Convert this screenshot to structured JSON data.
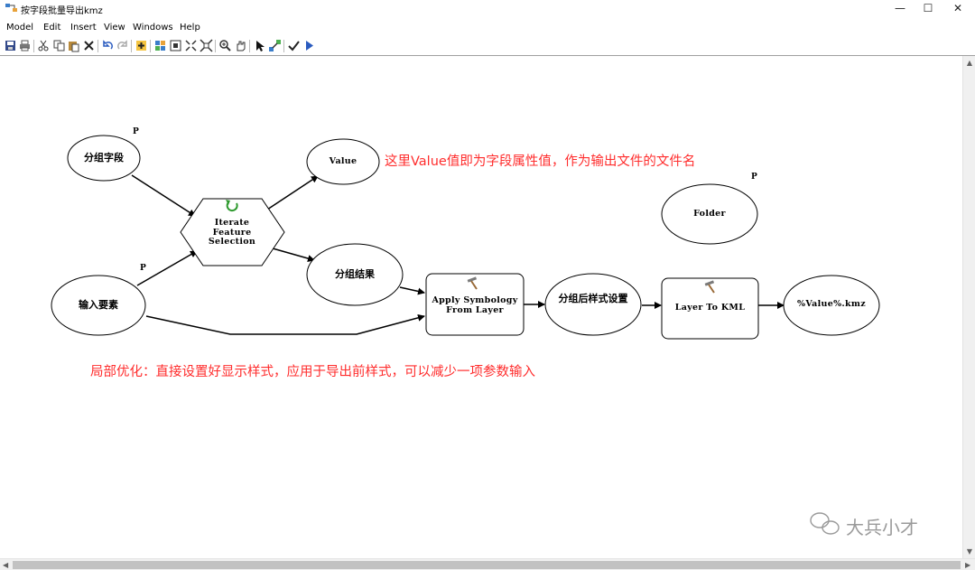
{
  "window": {
    "title": "按字段批量导出kmz",
    "minimize": "—",
    "maximize": "☐",
    "close": "✕"
  },
  "menu": [
    "Model",
    "Edit",
    "Insert",
    "View",
    "Windows",
    "Help"
  ],
  "toolbar_icons": [
    "save-icon",
    "print-icon",
    "cut-icon",
    "copy-icon",
    "paste-icon",
    "delete-icon",
    "undo-icon",
    "redo-icon",
    "add-data-icon",
    "auto-layout-icon",
    "full-extent-icon",
    "fixed-zoom-out-icon",
    "fixed-zoom-in-icon",
    "zoom-in-icon",
    "pan-icon",
    "select-icon",
    "connect-icon",
    "validate-icon",
    "run-icon"
  ],
  "nodes": {
    "group_field": "分组字段",
    "input_features": "输入要素",
    "iterate_line1": "Iterate",
    "iterate_line2": "Feature",
    "iterate_line3": "Selection",
    "value": "Value",
    "group_result": "分组结果",
    "apply_line1": "Apply Symbology",
    "apply_line2": "From Layer",
    "styled_group": "分组后样式设置",
    "layer_to_kml": "Layer To KML",
    "folder": "Folder",
    "output_kmz": "%Value%.kmz",
    "p_flag": "P"
  },
  "notes": {
    "value_note": "这里Value值即为字段属性值，作为输出文件的文件名",
    "optimization_note": "局部优化：直接设置好显示样式，应用于导出前样式，可以减少一项参数输入"
  },
  "watermark": "大兵小才",
  "colors": {
    "note": "#ff2d2d",
    "iterate_icon": "#2e9a2e"
  }
}
